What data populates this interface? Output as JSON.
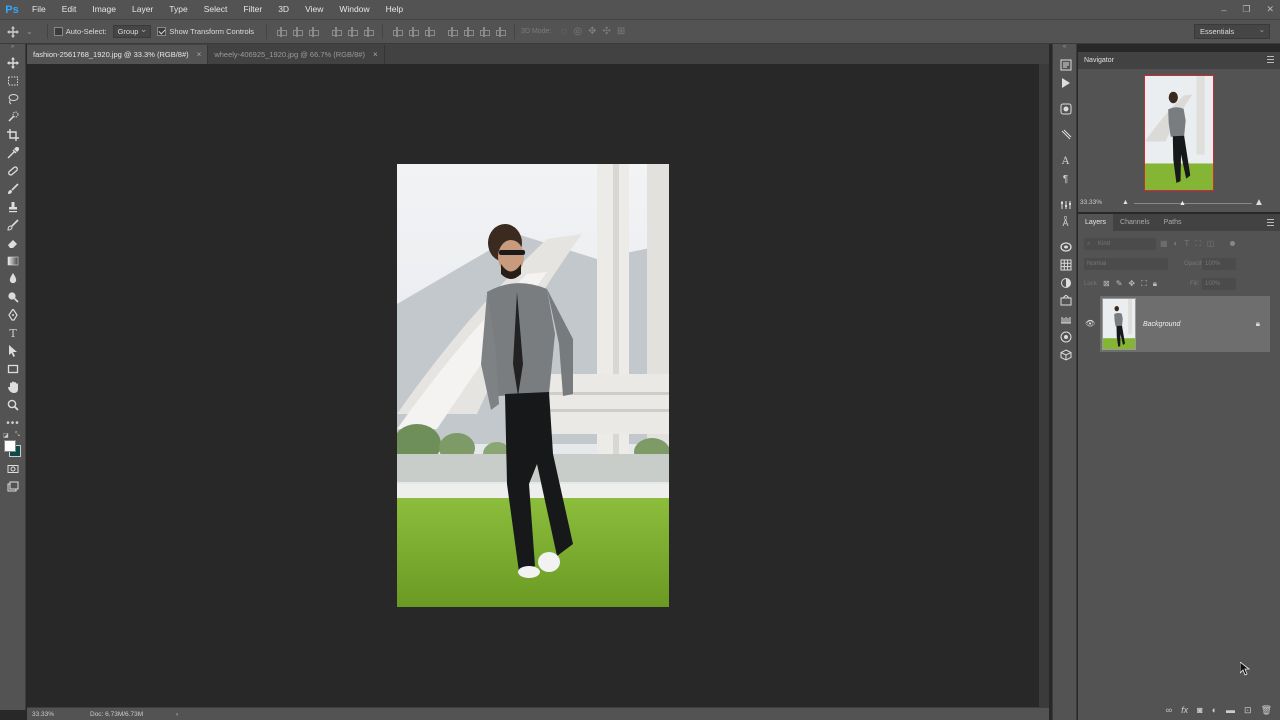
{
  "app": {
    "logo": "Ps"
  },
  "menu": [
    "File",
    "Edit",
    "Image",
    "Layer",
    "Type",
    "Select",
    "Filter",
    "3D",
    "View",
    "Window",
    "Help"
  ],
  "window_controls": [
    "–",
    "❐",
    "✕"
  ],
  "options": {
    "auto_select_label": "Auto-Select:",
    "auto_select_value": "Group",
    "show_transform_label": "Show Transform Controls",
    "mode_3d_label": "3D Mode:",
    "workspace": "Essentials"
  },
  "tabs": [
    {
      "label": "fashion-2561768_1920.jpg @ 33.3% (RGB/8#)",
      "close": "×"
    },
    {
      "label": "wheely-406925_1920.jpg @ 66.7% (RGB/8#)",
      "close": "×"
    }
  ],
  "status": {
    "zoom": "33.33%",
    "doc": "Doc: 6.73M/6.73M",
    "arrow": "›"
  },
  "navigator": {
    "title": "Navigator",
    "zoom": "33.33%"
  },
  "layers_panel": {
    "tabs": [
      "Layers",
      "Channels",
      "Paths"
    ],
    "kind_placeholder": "Kind",
    "blend_mode": "Normal",
    "opacity_label": "Opacity:",
    "opacity_value": "100%",
    "lock_label": "Lock:",
    "fill_label": "Fill:",
    "fill_value": "100%",
    "layer_name": "Background"
  },
  "colors": {
    "accent": "#31a8ff",
    "nav_frame": "#d0292f"
  }
}
